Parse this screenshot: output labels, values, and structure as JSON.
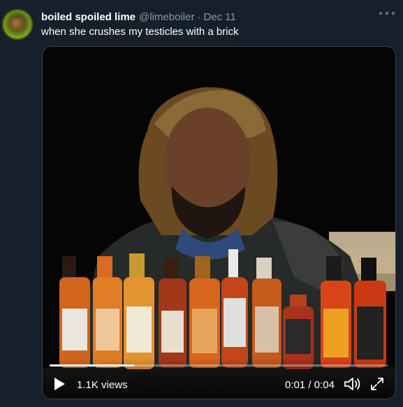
{
  "tweet": {
    "display_name": "boiled spoiled lime",
    "handle": "@limeboiler",
    "separator": "·",
    "date": "Dec 11",
    "text": "when she crushes my testicles with a brick"
  },
  "media": {
    "views": "1.1K views",
    "time_elapsed": "0:01",
    "time_separator": " / ",
    "time_total": "0:04",
    "progress": 0.25
  },
  "colors": {
    "background": "#15202b",
    "secondary_text": "#8899a6",
    "primary_text": "#ffffff"
  },
  "icons": [
    "more-icon",
    "play-icon",
    "volume-icon",
    "fullscreen-icon"
  ]
}
